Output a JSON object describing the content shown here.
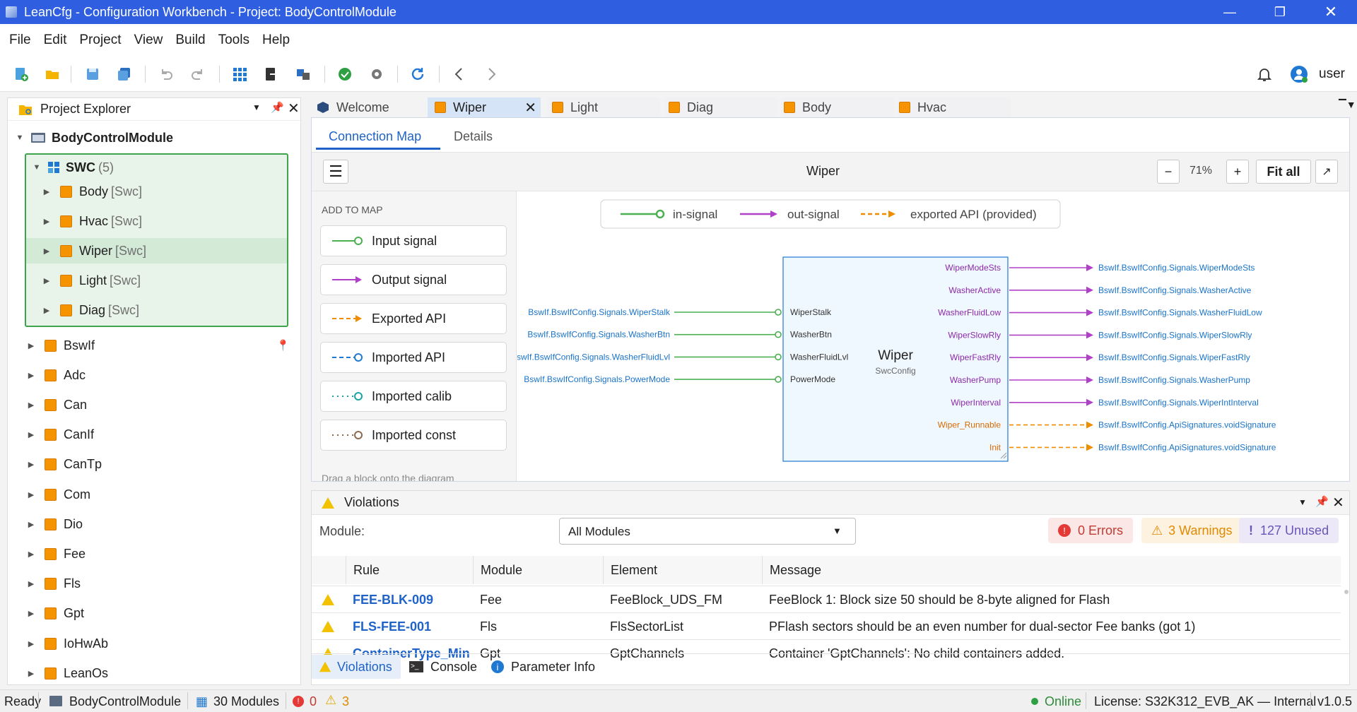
{
  "window": {
    "title": "LeanCfg - Configuration Workbench - Project: BodyControlModule"
  },
  "menu": [
    "File",
    "Edit",
    "Project",
    "View",
    "Build",
    "Tools",
    "Help"
  ],
  "user": {
    "name": "user"
  },
  "explorer": {
    "title": "Project Explorer",
    "root": "BodyControlModule",
    "swc": {
      "label": "SWC",
      "count": "(5)",
      "items": [
        {
          "name": "Body",
          "tag": "[Swc]"
        },
        {
          "name": "Hvac",
          "tag": "[Swc]"
        },
        {
          "name": "Wiper",
          "tag": "[Swc]"
        },
        {
          "name": "Light",
          "tag": "[Swc]"
        },
        {
          "name": "Diag",
          "tag": "[Swc]"
        }
      ]
    },
    "modules": [
      "BswIf",
      "Adc",
      "Can",
      "CanIf",
      "CanTp",
      "Com",
      "Dio",
      "Fee",
      "Fls",
      "Gpt",
      "IoHwAb",
      "LeanOs"
    ]
  },
  "doc_tabs": [
    "Welcome",
    "Wiper",
    "Light",
    "Diag",
    "Body",
    "Hvac"
  ],
  "editor": {
    "subtabs": [
      "Connection Map",
      "Details"
    ],
    "title": "Wiper",
    "zoom": "71%",
    "minus": "−",
    "plus": "+",
    "fit_all": "Fit all",
    "palette_title": "ADD TO MAP",
    "palette": [
      "Input signal",
      "Output signal",
      "Exported API",
      "Imported API",
      "Imported calib",
      "Imported const"
    ],
    "palette_hint": "Drag a block onto the diagram",
    "legend": [
      "in-signal",
      "out-signal",
      "exported API (provided)"
    ],
    "block": {
      "name": "Wiper",
      "sub": "SwcConfig"
    },
    "inputs": [
      {
        "port": "WiperStalk",
        "signal": "BswIf.BswIfConfig.Signals.WiperStalk"
      },
      {
        "port": "WasherBtn",
        "signal": "BswIf.BswIfConfig.Signals.WasherBtn"
      },
      {
        "port": "WasherFluidLvl",
        "signal": "BswIf.BswIfConfig.Signals.WasherFluidLvl"
      },
      {
        "port": "PowerMode",
        "signal": "BswIf.BswIfConfig.Signals.PowerMode"
      }
    ],
    "outputs": [
      {
        "port": "WiperModeSts",
        "signal": "BswIf.BswIfConfig.Signals.WiperModeSts",
        "kind": "out"
      },
      {
        "port": "WasherActive",
        "signal": "BswIf.BswIfConfig.Signals.WasherActive",
        "kind": "out"
      },
      {
        "port": "WasherFluidLow",
        "signal": "BswIf.BswIfConfig.Signals.WasherFluidLow",
        "kind": "out"
      },
      {
        "port": "WiperSlowRly",
        "signal": "BswIf.BswIfConfig.Signals.WiperSlowRly",
        "kind": "out"
      },
      {
        "port": "WiperFastRly",
        "signal": "BswIf.BswIfConfig.Signals.WiperFastRly",
        "kind": "out"
      },
      {
        "port": "WasherPump",
        "signal": "BswIf.BswIfConfig.Signals.WasherPump",
        "kind": "out"
      },
      {
        "port": "WiperInterval",
        "signal": "BswIf.BswIfConfig.Signals.WiperIntInterval",
        "kind": "out"
      },
      {
        "port": "Wiper_Runnable",
        "signal": "BswIf.BswIfConfig.ApiSignatures.voidSignature",
        "kind": "api"
      },
      {
        "port": "Init",
        "signal": "BswIf.BswIfConfig.ApiSignatures.voidSignature",
        "kind": "api"
      }
    ]
  },
  "violations": {
    "title": "Violations",
    "module_label": "Module:",
    "module_value": "All Modules",
    "errors": "0 Errors",
    "warnings": "3 Warnings",
    "unused": "127 Unused",
    "columns": [
      "Rule",
      "Module",
      "Element",
      "Message"
    ],
    "rows": [
      {
        "rule": "FEE-BLK-009",
        "module": "Fee",
        "element": "FeeBlock_UDS_FM",
        "message": "FeeBlock 1: Block size 50 should be 8-byte aligned for Flash"
      },
      {
        "rule": "FLS-FEE-001",
        "module": "Fls",
        "element": "FlsSectorList",
        "message": "PFlash sectors should be an even number for dual-sector Fee banks (got 1)"
      },
      {
        "rule": "ContainerType_Minir",
        "module": "Gpt",
        "element": "GptChannels",
        "message": "Container 'GptChannels': No child containers added."
      }
    ],
    "bottom_tabs": [
      "Violations",
      "Console",
      "Parameter Info"
    ]
  },
  "status": {
    "ready": "Ready",
    "project": "BodyControlModule",
    "modules": "30 Modules",
    "errors": "0",
    "warnings": "3",
    "online": "Online",
    "license": "License:  S32K312_EVB_AK — Internal",
    "version": "v1.0.5"
  },
  "colors": {
    "accent": "#2f5fe0",
    "in": "#4caf50",
    "out": "#b040c8",
    "api": "#f08c00",
    "link": "#1a73c9"
  }
}
